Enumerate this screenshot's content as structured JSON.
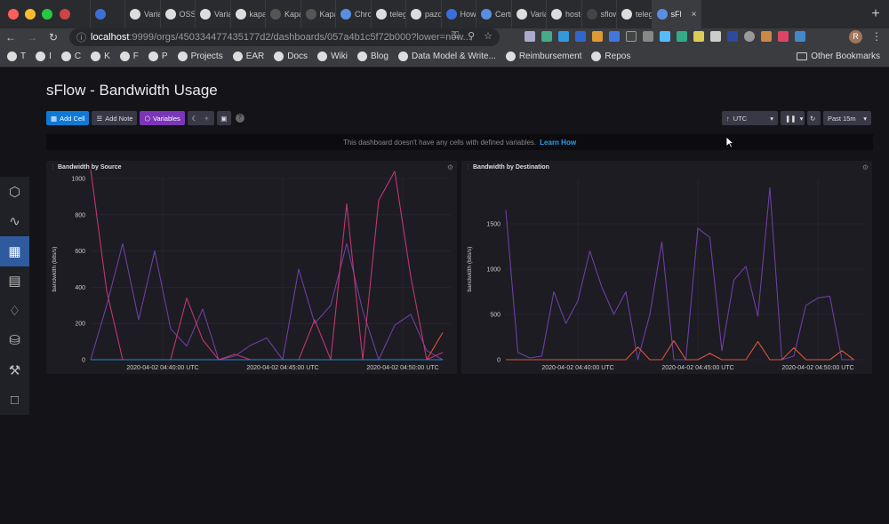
{
  "browser": {
    "tabs": [
      {
        "label": "",
        "color": "#c44"
      },
      {
        "label": "",
        "color": "#3b6fd8"
      },
      {
        "label": "Variab",
        "color": "#ddd"
      },
      {
        "label": "OSS G",
        "color": "#ddd"
      },
      {
        "label": "Variab",
        "color": "#ddd"
      },
      {
        "label": "kapac",
        "color": "#ddd"
      },
      {
        "label": "Kapac",
        "color": "#555"
      },
      {
        "label": "Kapac",
        "color": "#555"
      },
      {
        "label": "Chron",
        "color": "#5a8fe0"
      },
      {
        "label": "telegr",
        "color": "#ddd"
      },
      {
        "label": "pazde",
        "color": "#ddd"
      },
      {
        "label": "How t",
        "color": "#3b6fd8"
      },
      {
        "label": "Certifi",
        "color": "#5a8fe0"
      },
      {
        "label": "Variab",
        "color": "#ddd"
      },
      {
        "label": "host-s",
        "color": "#ddd"
      },
      {
        "label": "sflow/",
        "color": "#444"
      },
      {
        "label": "telegr",
        "color": "#ddd"
      },
      {
        "label": "sFl",
        "color": "#5a8fe0",
        "active": true
      }
    ],
    "url_host": "localhost",
    "url_path": ":9999/orgs/450334477435177d2/dashboards/057a4b1c5f72b000?lower=now...",
    "avatar_initial": "R",
    "bookmarks": [
      "T",
      "I",
      "C",
      "K",
      "F",
      "P",
      "Projects",
      "EAR",
      "Docs",
      "Wiki",
      "Blog",
      "Data Model & Write...",
      "Reimbursement",
      "Repos"
    ],
    "other_bookmarks": "Other Bookmarks"
  },
  "dashboard": {
    "title": "sFlow - Bandwidth Usage",
    "toolbar": {
      "add_cell": "Add Cell",
      "add_note": "Add Note",
      "variables": "Variables"
    },
    "timezone": "UTC",
    "time_range": "Past 15m",
    "notice_text": "This dashboard doesn't have any cells with defined variables.",
    "notice_link": "Learn How"
  },
  "colors": {
    "accent_blue": "#0f79d6",
    "accent_purple": "#7b36b8",
    "series_purple": "#6d3fa3",
    "series_red": "#c2366d",
    "series_orange": "#e0543a",
    "series_blue": "#1f8ad8"
  },
  "chart_data": [
    {
      "type": "line",
      "title": "Bandwidth by Source",
      "ylabel": "bandwidth (bits/s)",
      "ylim": [
        0,
        1000
      ],
      "yticks": [
        0,
        200,
        400,
        600,
        800,
        1000
      ],
      "xlim": [
        "2020-04-02 04:37:00",
        "2020-04-02 04:52:00"
      ],
      "xticks": [
        "2020-04-02 04:40:00 UTC",
        "2020-04-02 04:45:00 UTC",
        "2020-04-02 04:50:00 UTC"
      ],
      "x": [
        "04:37:00",
        "04:37:40",
        "04:38:20",
        "04:39:00",
        "04:39:40",
        "04:40:20",
        "04:41:00",
        "04:41:40",
        "04:42:20",
        "04:43:00",
        "04:43:40",
        "04:44:20",
        "04:45:00",
        "04:45:40",
        "04:46:20",
        "04:47:00",
        "04:47:40",
        "04:48:20",
        "04:49:00",
        "04:49:40",
        "04:50:20",
        "04:51:00",
        "04:51:40"
      ],
      "series": [
        {
          "color": "#6d3fa3",
          "values": [
            0,
            300,
            640,
            220,
            600,
            170,
            75,
            280,
            0,
            20,
            80,
            120,
            0,
            500,
            200,
            300,
            640,
            270,
            0,
            190,
            250,
            50,
            0
          ]
        },
        {
          "color": "#c2366d",
          "values": [
            1050,
            380,
            0,
            0,
            0,
            0,
            340,
            110,
            0,
            30,
            0,
            0,
            0,
            0,
            220,
            0,
            860,
            0,
            880,
            1040,
            460,
            0,
            40
          ]
        },
        {
          "color": "#e0543a",
          "values": [
            0,
            0,
            0,
            0,
            0,
            0,
            0,
            0,
            0,
            0,
            0,
            0,
            0,
            0,
            0,
            0,
            0,
            0,
            0,
            0,
            0,
            0,
            150
          ]
        },
        {
          "color": "#1f8ad8",
          "values": [
            0,
            0,
            0,
            0,
            0,
            0,
            0,
            0,
            0,
            0,
            0,
            0,
            0,
            0,
            0,
            0,
            0,
            0,
            0,
            0,
            0,
            0,
            0
          ]
        }
      ]
    },
    {
      "type": "line",
      "title": "Bandwidth by Destination",
      "ylabel": "bandwidth (bits/s)",
      "ylim": [
        0,
        2000
      ],
      "yticks": [
        0,
        500,
        1000,
        1500
      ],
      "xlim": [
        "2020-04-02 04:37:00",
        "2020-04-02 04:52:00"
      ],
      "xticks": [
        "2020-04-02 04:40:00 UTC",
        "2020-04-02 04:45:00 UTC",
        "2020-04-02 04:50:00 UTC"
      ],
      "x": [
        "04:37:00",
        "04:37:30",
        "04:38:00",
        "04:38:30",
        "04:39:00",
        "04:39:30",
        "04:40:00",
        "04:40:30",
        "04:41:00",
        "04:41:30",
        "04:42:00",
        "04:42:30",
        "04:43:00",
        "04:43:30",
        "04:44:00",
        "04:44:30",
        "04:45:00",
        "04:45:30",
        "04:46:00",
        "04:46:30",
        "04:47:00",
        "04:47:30",
        "04:48:00",
        "04:48:30",
        "04:49:00",
        "04:49:30",
        "04:50:00",
        "04:50:30",
        "04:51:00",
        "04:51:30"
      ],
      "series": [
        {
          "color": "#6d3fa3",
          "values": [
            1650,
            80,
            20,
            40,
            750,
            400,
            650,
            1200,
            800,
            500,
            750,
            0,
            500,
            1300,
            0,
            0,
            1450,
            1350,
            100,
            880,
            1030,
            480,
            1900,
            0,
            40,
            600,
            680,
            700,
            0,
            0
          ]
        },
        {
          "color": "#e0543a",
          "values": [
            0,
            0,
            0,
            0,
            0,
            0,
            0,
            0,
            0,
            0,
            0,
            140,
            0,
            0,
            210,
            0,
            0,
            70,
            0,
            0,
            0,
            200,
            0,
            0,
            130,
            0,
            0,
            0,
            100,
            0
          ]
        }
      ]
    }
  ]
}
